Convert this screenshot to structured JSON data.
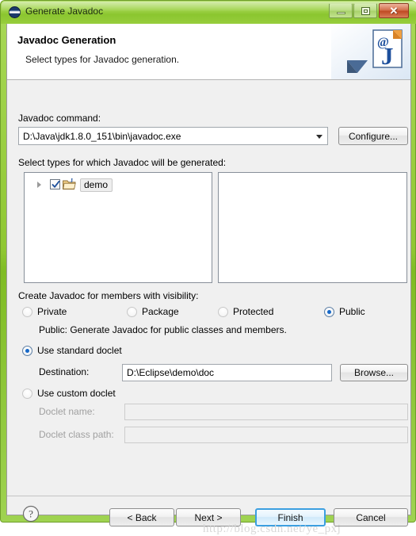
{
  "window": {
    "title": "Generate Javadoc",
    "title_icon": "javadoc-circle-icon",
    "controls": {
      "minimize": "minimize-icon",
      "maximize": "maximize-icon",
      "close": "close-icon",
      "close_glyph": "✕"
    },
    "frame_color": "#8fc732",
    "titlebar_color": "#9ed249"
  },
  "banner": {
    "title": "Javadoc Generation",
    "subtitle": "Select types for Javadoc generation.",
    "art": "javadoc-at-j-page-icon"
  },
  "command": {
    "label": "Javadoc command:",
    "value": "D:\\Java\\jdk1.8.0_151\\bin\\javadoc.exe",
    "configure_label": "Configure..."
  },
  "types": {
    "label": "Select types for which Javadoc will be generated:",
    "tree": [
      {
        "label": "demo",
        "checked": true,
        "expanded": false,
        "icon": "java-project-folder-icon",
        "selected": true
      }
    ],
    "right_list_items": []
  },
  "visibility": {
    "label": "Create Javadoc for members with visibility:",
    "options": [
      {
        "label": "Private",
        "selected": false
      },
      {
        "label": "Package",
        "selected": false
      },
      {
        "label": "Protected",
        "selected": false
      },
      {
        "label": "Public",
        "selected": true
      }
    ],
    "description": "Public: Generate Javadoc for public classes and members."
  },
  "doclet": {
    "standard": {
      "label": "Use standard doclet",
      "selected": true
    },
    "destination": {
      "label": "Destination:",
      "value": "D:\\Eclipse\\demo\\doc",
      "browse_label": "Browse..."
    },
    "custom": {
      "label": "Use custom doclet",
      "selected": false
    },
    "doclet_name": {
      "label": "Doclet name:",
      "value": "",
      "enabled": false
    },
    "doclet_class_path": {
      "label": "Doclet class path:",
      "value": "",
      "enabled": false
    }
  },
  "footer": {
    "help": "help-icon",
    "back_label": "< Back",
    "next_label": "Next >",
    "finish_label": "Finish",
    "cancel_label": "Cancel",
    "default_button": "Finish",
    "accent_color": "#3c9fe0"
  },
  "watermark": "http://blog.csdn.net/ye_pxj"
}
